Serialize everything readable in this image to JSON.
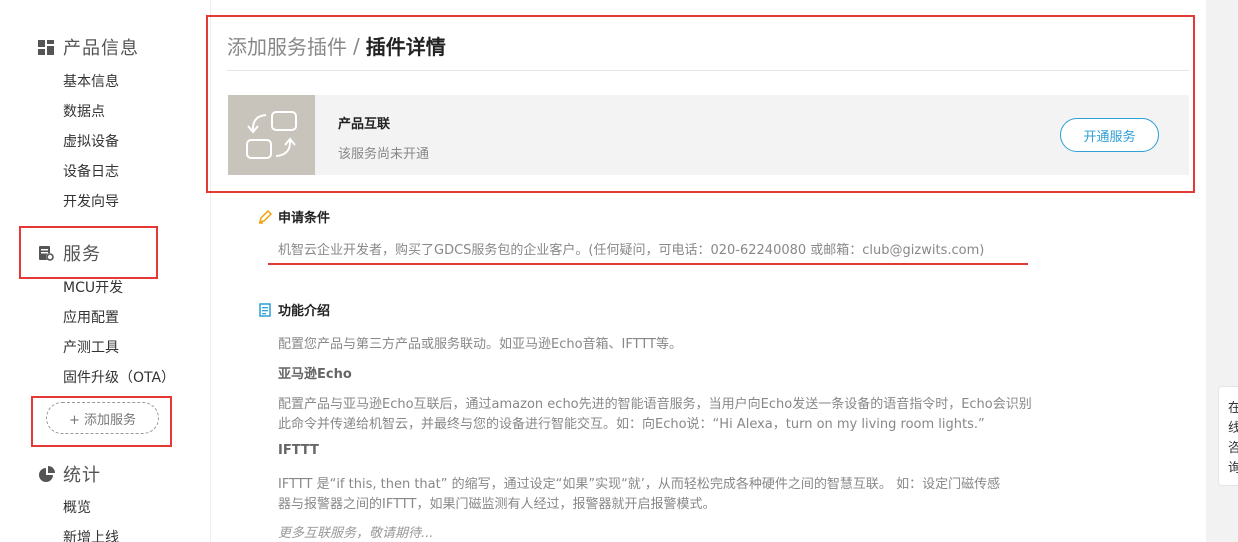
{
  "sidebar": {
    "sections": {
      "product": {
        "title": "产品信息",
        "items": [
          "基本信息",
          "数据点",
          "虚拟设备",
          "设备日志",
          "开发向导"
        ]
      },
      "service": {
        "title": "服务",
        "items": [
          "MCU开发",
          "应用配置",
          "产测工具",
          "固件升级（OTA）"
        ],
        "add_button": "+ 添加服务"
      },
      "stats": {
        "title": "统计",
        "items": [
          "概览",
          "新增上线"
        ]
      }
    }
  },
  "main": {
    "breadcrumb": {
      "parent": "添加服务插件",
      "separator": "/",
      "current": "插件详情"
    },
    "plugin": {
      "name": "产品互联",
      "status": "该服务尚未开通",
      "open_button": "开通服务"
    },
    "conditions": {
      "title": "申请条件",
      "text": "机智云企业开发者，购买了GDCS服务包的企业客户。(任何疑问，可电话：020-62240080 或邮箱：club@gizwits.com)"
    },
    "features": {
      "title": "功能介绍",
      "intro": "配置您产品与第三方产品或服务联动。如亚马逊Echo音箱、IFTTT等。",
      "echo_title": "亚马逊Echo",
      "echo_line1": "配置产品与亚马逊Echo互联后，通过amazon echo先进的智能语音服务，当用户向Echo发送一条设备的语音指令时，Echo会识别",
      "echo_line2": "此命令并传递给机智云，并最终与您的设备进行智能交互。如：向Echo说：“Hi Alexa，turn on my living room lights.”",
      "ifttt_title": "IFTTT",
      "ifttt_line1": "IFTTT 是“if this, then that” 的缩写，通过设定“如果”实现“就’，从而轻松完成各种硬件之间的智慧互联。 如：设定门磁传感",
      "ifttt_line2": "器与报警器之间的IFTTT，如果门磁监测有人经过，报警器就开启报警模式。",
      "more": "更多互联服务，敬请期待..."
    }
  },
  "float_widget": {
    "chars": [
      "在",
      "线",
      "咨",
      "询"
    ]
  },
  "colors": {
    "accent": "#2f9fd6",
    "annotation": "#e53935",
    "icon_bg": "#c8c3bb"
  }
}
